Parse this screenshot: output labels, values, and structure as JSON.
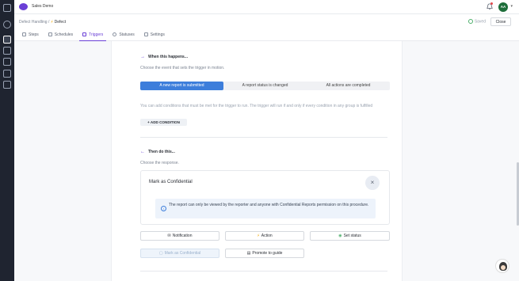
{
  "app": {
    "name": "Sales Demo"
  },
  "user": {
    "initials": "AA"
  },
  "breadcrumb": {
    "parent": "Defect Handling",
    "separator": "/",
    "current": "Defect"
  },
  "status": {
    "saved_label": "Saved"
  },
  "header": {
    "close_label": "Close"
  },
  "tabs": [
    {
      "label": "Steps"
    },
    {
      "label": "Schedules"
    },
    {
      "label": "Triggers"
    },
    {
      "label": "Statuses"
    },
    {
      "label": "Settings"
    }
  ],
  "trigger": {
    "when_title": "When this happens...",
    "when_desc": "Choose the event that sets the trigger in motion.",
    "options": [
      "A new report is submitted",
      "A report status is changed",
      "All actions are completed"
    ],
    "conditions_text": "You can add conditions that must be met for the trigger to run. The trigger will run if and only if every condition in any group is fulfilled",
    "add_condition_label": "ADD CONDITION",
    "then_title": "Then do this...",
    "then_desc": "Choose the response."
  },
  "response_card": {
    "title": "Mark as Confidential",
    "info": "The report can only be viewed by the reporter and anyone with Confidential Reports permission on this procedure."
  },
  "actions": {
    "notification": "Notification",
    "action": "Action",
    "set_status": "Set status",
    "mark_confidential": "Mark as Confidential",
    "promote_guide": "Promote to guide"
  },
  "colors": {
    "accent": "#6a3fd6",
    "primary": "#3d7edb",
    "sidebar": "#1f2430"
  }
}
